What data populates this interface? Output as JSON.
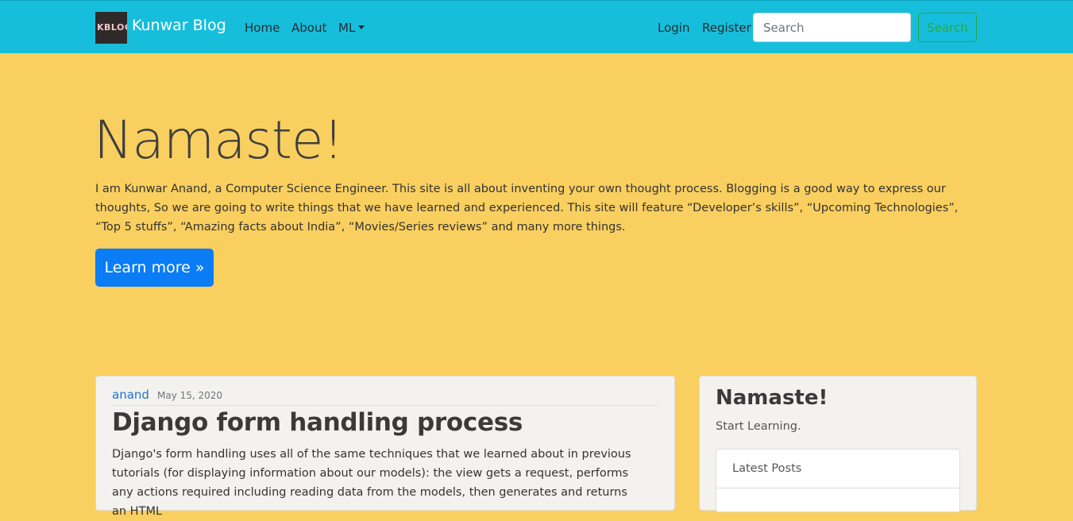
{
  "navbar": {
    "logo_text": "KBLOG",
    "brand": "Kunwar Blog",
    "links": [
      {
        "label": "Home"
      },
      {
        "label": "About"
      },
      {
        "label": "ML"
      }
    ],
    "login": "Login",
    "register": "Register",
    "search_placeholder": "Search",
    "search_button": "Search",
    "color": "#17bedb"
  },
  "hero": {
    "title": "Namaste!",
    "text": "I am Kunwar Anand, a Computer Science Engineer. This site is all about inventing your own thought process. Blogging is a good way to express our thoughts, So we are going to write things that we have learned and experienced. This site will feature “Developer’s skills”, “Upcoming Technologies”, “Top 5 stuffs”, “Amazing facts about India”, “Movies/Series reviews” and many more things.",
    "button": "Learn more »",
    "background": "#f9cf5f"
  },
  "post": {
    "author": "anand",
    "date": "May 15, 2020",
    "title": "Django form handling process",
    "excerpt": "Django's form handling uses all of the same techniques that we learned about in previous tutorials (for displaying information about our models): the view gets a request, performs any actions required including reading data from the models, then generates and returns an HTML"
  },
  "sidebar": {
    "title": "Namaste!",
    "subtitle": "Start Learning.",
    "latest_label": "Latest Posts"
  }
}
